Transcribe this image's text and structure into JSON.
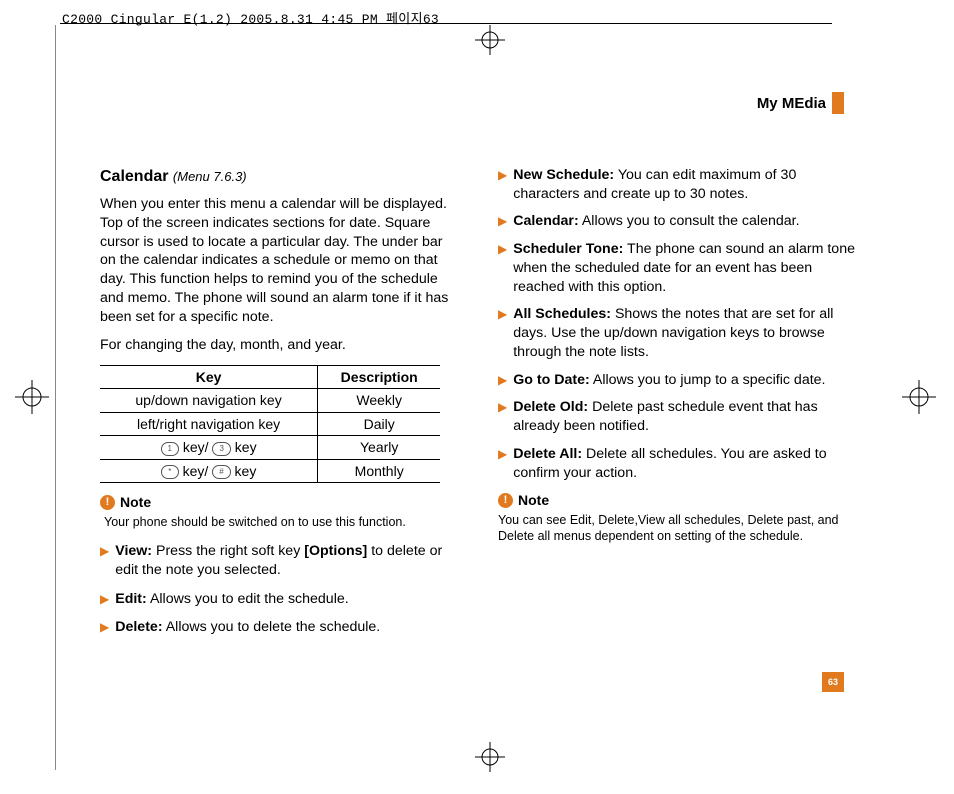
{
  "header": "C2000 Cingular  E(1.2)  2005.8.31 4:45 PM  페이지63",
  "section": "My MEdia",
  "page_number": "63",
  "left": {
    "title": "Calendar",
    "menuref": "(Menu 7.6.3)",
    "intro": "When you enter this menu a calendar will be displayed. Top of the screen indicates sections for date. Square cursor is used to locate a particular day. The under bar on the calendar indicates a schedule or memo on that day. This function helps to remind you of the schedule and memo. The phone will sound an alarm tone if it has been set for a specific note.",
    "changing": "For changing the day, month, and year.",
    "table": {
      "head": [
        "Key",
        "Description"
      ],
      "rows": [
        [
          "up/down navigation key",
          "Weekly"
        ],
        [
          "left/right navigation key",
          "Daily"
        ],
        [
          "KEYCAP1 key/ KEYCAP3 key",
          "Yearly"
        ],
        [
          "KEYCAP* key/ KEYCAP# key",
          "Monthly"
        ]
      ]
    },
    "note_label": "Note",
    "note_body": "Your phone should be switched on to use this function.",
    "items": [
      {
        "lead": "View:",
        "body": "Press the right soft key [Options] to delete or edit the note you selected.",
        "bold_inline": "[Options]"
      },
      {
        "lead": "Edit:",
        "body": "Allows you to edit the schedule."
      },
      {
        "lead": "Delete:",
        "body": "Allows you to delete the schedule."
      }
    ]
  },
  "right": {
    "items": [
      {
        "lead": "New Schedule:",
        "body": "You can edit maximum of 30 characters and create up to 30 notes."
      },
      {
        "lead": "Calendar:",
        "body": "Allows you to consult the calendar."
      },
      {
        "lead": "Scheduler Tone:",
        "body": "The phone can sound an alarm tone when the scheduled date for an event has been reached with this option."
      },
      {
        "lead": "All Schedules:",
        "body": "Shows the notes that are set for all days. Use the up/down navigation keys to browse through the note lists."
      },
      {
        "lead": "Go to Date:",
        "body": "Allows you to jump to a specific date."
      },
      {
        "lead": "Delete Old:",
        "body": "Delete past schedule event that has already been notified."
      },
      {
        "lead": "Delete All:",
        "body": "Delete all schedules. You are asked to confirm your action."
      }
    ],
    "note_label": "Note",
    "note_body": "You can see Edit, Delete,View all schedules, Delete past, and Delete all menus dependent on setting of the schedule."
  }
}
